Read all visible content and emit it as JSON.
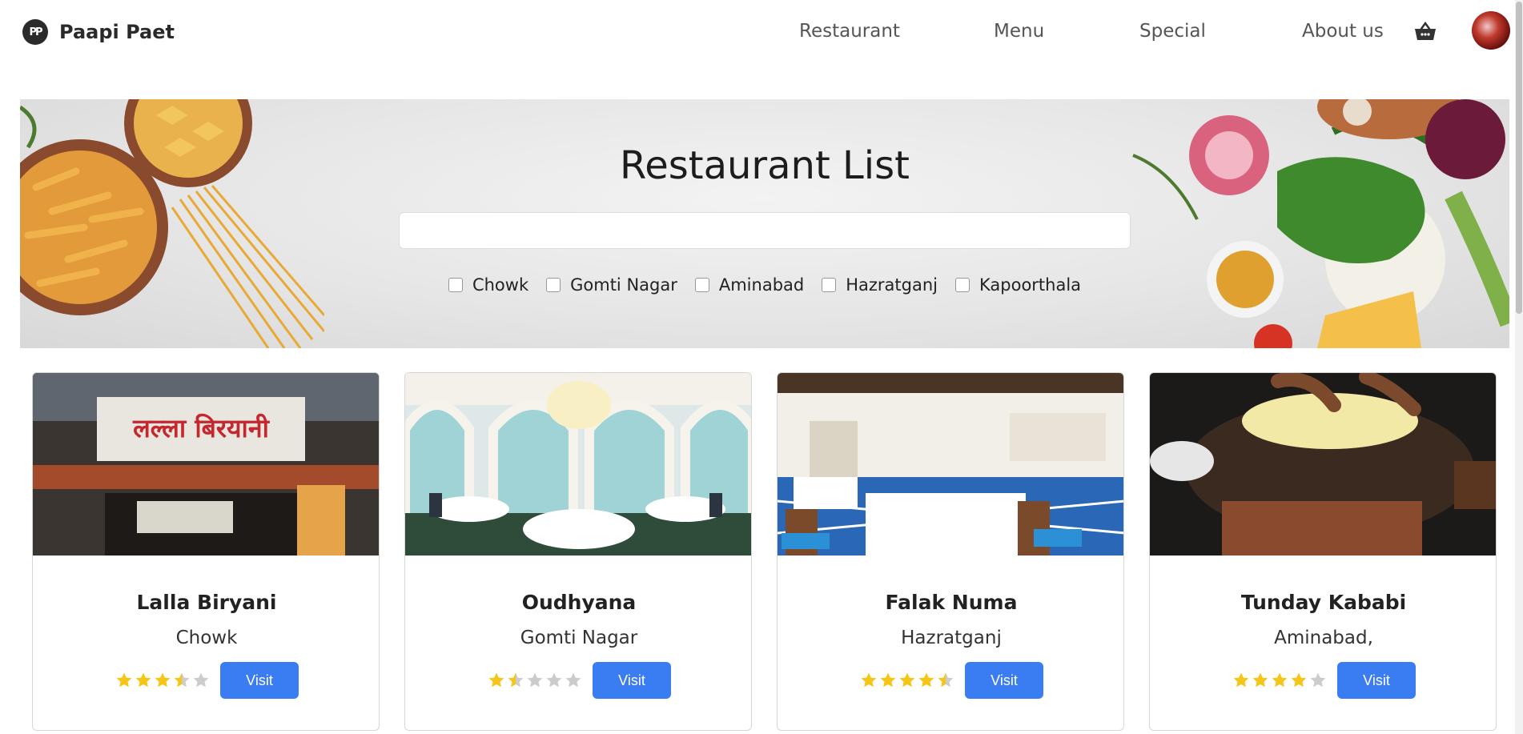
{
  "brand": {
    "name": "Paapi Paet",
    "logo_text": "PP"
  },
  "nav": {
    "links": [
      "Restaurant",
      "Menu",
      "Special",
      "About us"
    ],
    "cart_icon": "basket-icon",
    "avatar_icon": "user-avatar"
  },
  "hero": {
    "title": "Restaurant List",
    "search": {
      "value": "",
      "placeholder": ""
    },
    "filters": [
      "Chowk",
      "Gomti Nagar",
      "Aminabad",
      "Hazratganj",
      "Kapoorthala"
    ]
  },
  "restaurants": [
    {
      "name": "Lalla Biryani",
      "area": "Chowk",
      "rating": 3.5,
      "visit_label": "Visit",
      "sign_text": "लल्ला बिरयानी"
    },
    {
      "name": "Oudhyana",
      "area": "Gomti Nagar",
      "rating": 1.5,
      "visit_label": "Visit"
    },
    {
      "name": "Falak Numa",
      "area": "Hazratganj",
      "rating": 4.5,
      "visit_label": "Visit"
    },
    {
      "name": "Tunday Kababi",
      "area": "Aminabad,",
      "rating": 4,
      "visit_label": "Visit"
    }
  ],
  "colors": {
    "accent": "#3a7cf2",
    "star_filled": "#f5c518",
    "star_empty": "#cccccc"
  }
}
